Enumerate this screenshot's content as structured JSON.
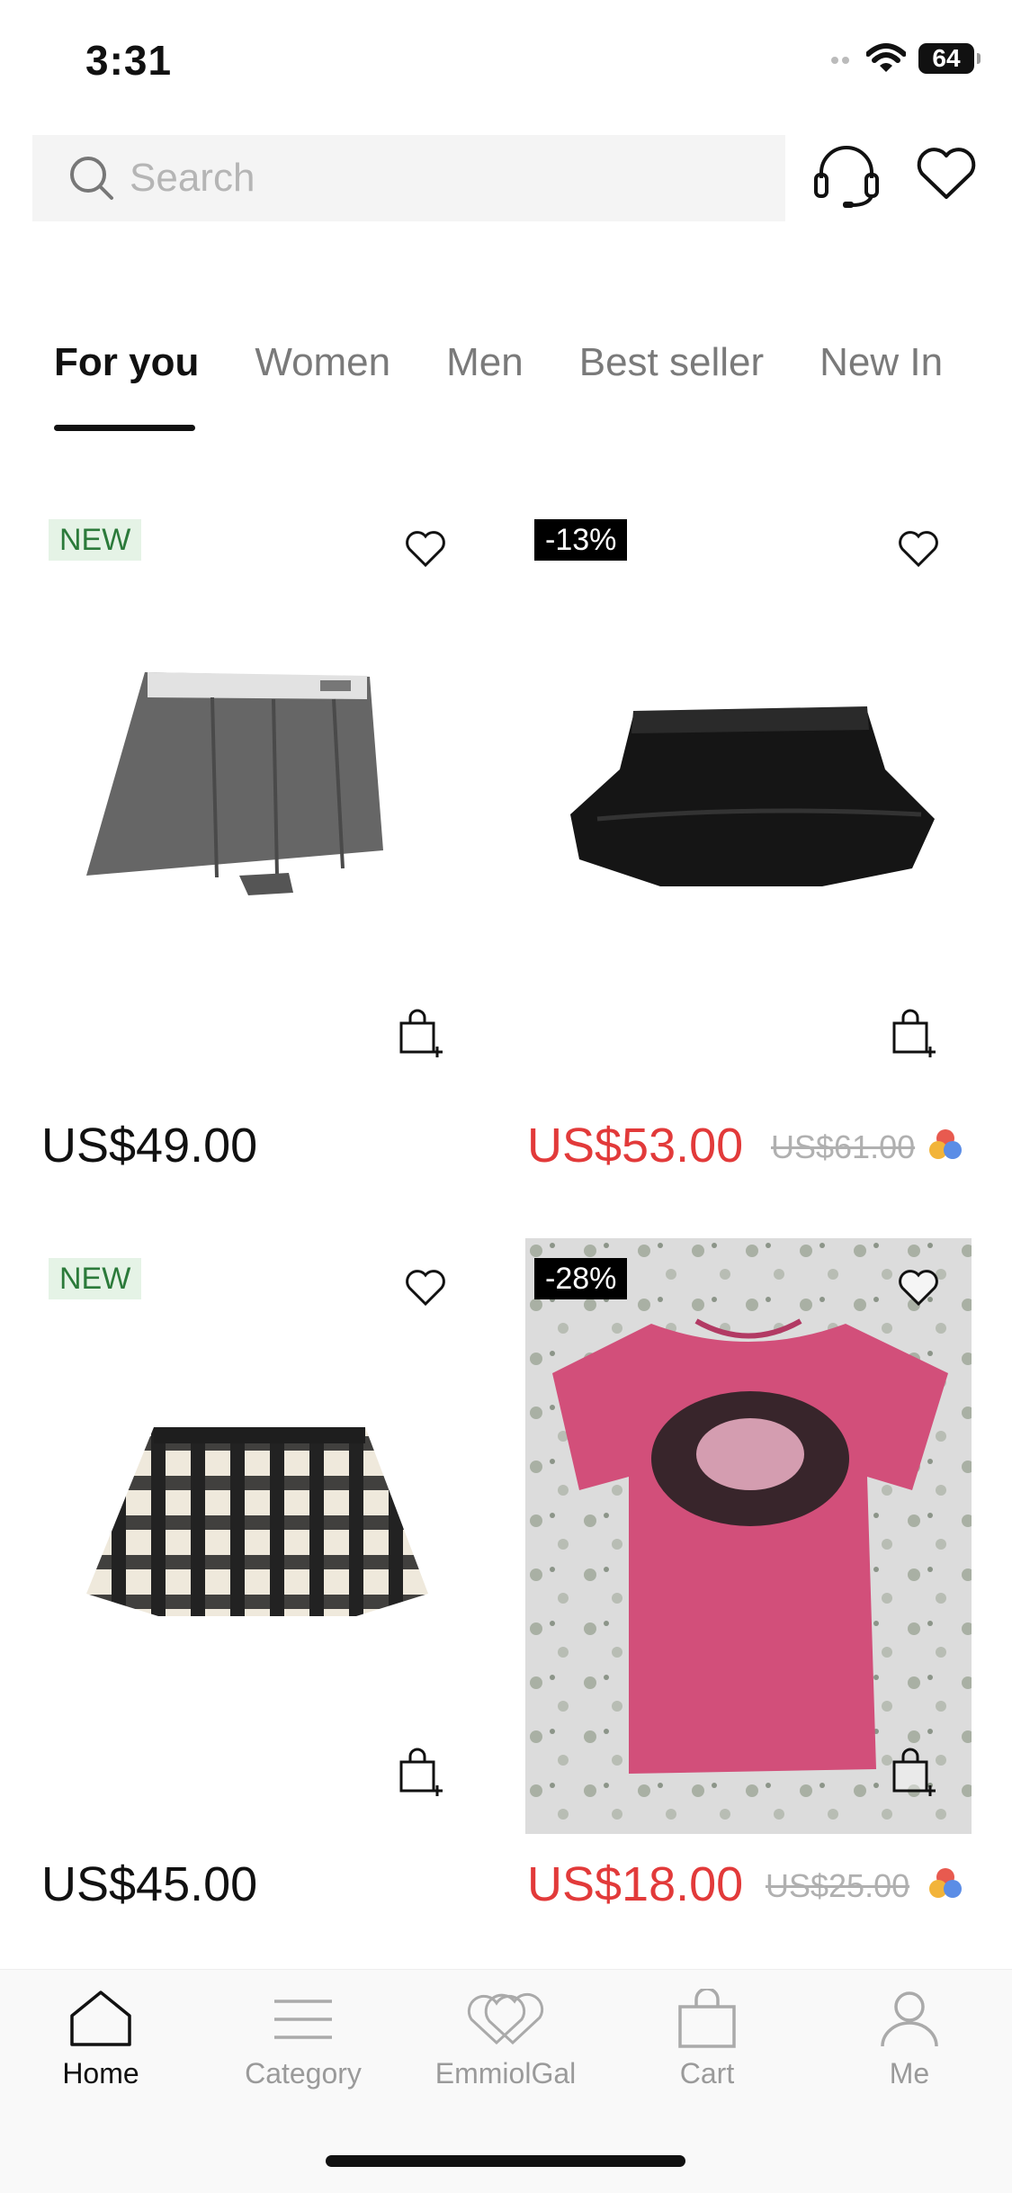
{
  "status_bar": {
    "time": "3:31",
    "battery": "64"
  },
  "search": {
    "placeholder": "Search"
  },
  "tabs": [
    {
      "label": "For you",
      "active": true
    },
    {
      "label": "Women"
    },
    {
      "label": "Men"
    },
    {
      "label": "Best seller"
    },
    {
      "label": "New In"
    }
  ],
  "products": [
    {
      "badge": "NEW",
      "badge_type": "new",
      "price": "US$49.00",
      "image": "grey-pleated-skort"
    },
    {
      "badge": "-13%",
      "badge_type": "discount",
      "price": "US$53.00",
      "old_price": "US$61.00",
      "image": "black-ruffle-skirt"
    },
    {
      "badge": "NEW",
      "badge_type": "new",
      "price": "US$45.00",
      "image": "plaid-pleated-skirt"
    },
    {
      "badge": "-28%",
      "badge_type": "discount",
      "price": "US$18.00",
      "old_price": "US$25.00",
      "image": "pink-graphic-tee"
    }
  ],
  "nav": [
    {
      "label": "Home",
      "active": true
    },
    {
      "label": "Category"
    },
    {
      "label": "EmmiolGal"
    },
    {
      "label": "Cart"
    },
    {
      "label": "Me"
    }
  ],
  "colors": {
    "accent_red": "#e23a3a",
    "new_badge_bg": "#e5f3e6",
    "new_badge_text": "#2b7a3a"
  }
}
